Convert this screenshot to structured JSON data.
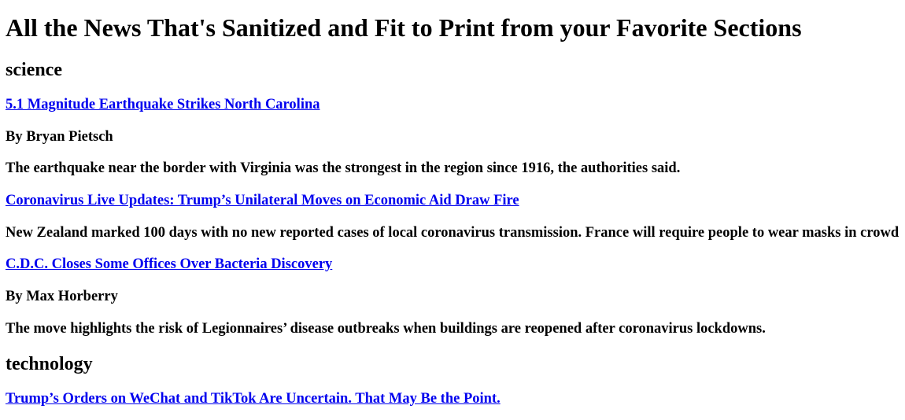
{
  "page_title": "All the News That's Sanitized and Fit to Print from your Favorite Sections",
  "sections": [
    {
      "name": "science",
      "articles": [
        {
          "headline": "5.1 Magnitude Earthquake Strikes North Carolina",
          "byline": "By Bryan Pietsch",
          "summary": "The earthquake near the border with Virginia was the strongest in the region since 1916, the authorities said."
        },
        {
          "headline": "Coronavirus Live Updates: Trump’s Unilateral Moves on Economic Aid Draw Fire",
          "summary": "New Zealand marked 100 days with no new reported cases of local coronavirus transmission. France will require people to wear masks in crowd"
        },
        {
          "headline": "C.D.C. Closes Some Offices Over Bacteria Discovery",
          "byline": "By Max Horberry",
          "summary": "The move highlights the risk of Legionnaires’ disease outbreaks when buildings are reopened after coronavirus lockdowns."
        }
      ]
    },
    {
      "name": "technology",
      "articles": [
        {
          "headline": "Trump’s Orders on WeChat and TikTok Are Uncertain. That May Be the Point."
        }
      ]
    }
  ],
  "colors": {
    "link": "#0000ee",
    "text": "#000000",
    "background": "#ffffff"
  }
}
